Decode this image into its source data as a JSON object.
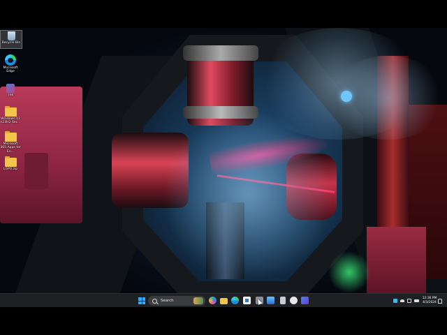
{
  "desktop": {
    "icons": [
      {
        "label": "Recycle Bin",
        "icon": "recycle-bin-icon"
      },
      {
        "label": "Microsoft Edge",
        "icon": "edge-icon"
      },
      {
        "label": ".lnk",
        "icon": "app-shortcut-icon"
      },
      {
        "label": "Windows 11 n23H2 Sec...",
        "icon": "folder-icon"
      },
      {
        "label": "Microsoft 365 Apps for En...",
        "icon": "folder-icon"
      },
      {
        "label": "LGPO.zip",
        "icon": "folder-icon"
      }
    ]
  },
  "taskbar": {
    "search_placeholder": "Search",
    "pinned_apps": [
      "copilot-icon",
      "file-explorer-icon",
      "edge-icon",
      "store-icon",
      "app-icon",
      "app-icon",
      "app-icon",
      "app-icon",
      "app-icon"
    ],
    "clock": {
      "time": "12:36 PM",
      "date": "4/3/2024"
    }
  },
  "colors": {
    "accent": "#3fa8f4",
    "taskbar": "#1f2023"
  }
}
